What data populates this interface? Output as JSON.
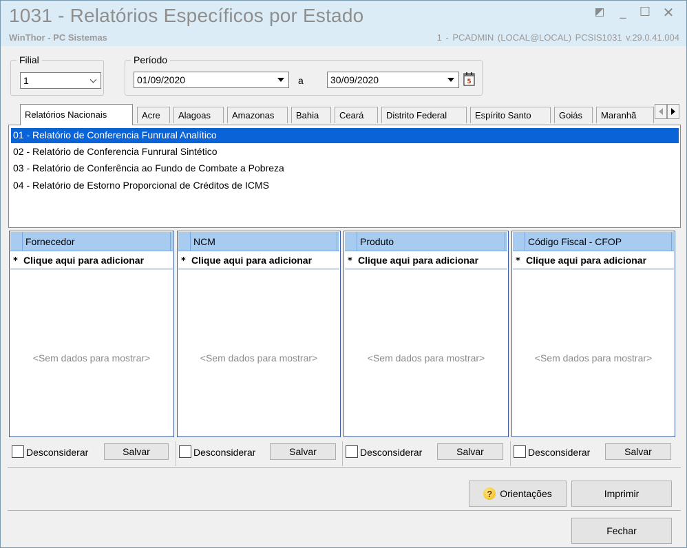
{
  "window": {
    "title": "1031 - Relatórios Específicos por Estado",
    "subtitle": "WinThor - PC Sistemas",
    "info": "1 - PCADMIN (LOCAL@LOCAL)  PCSIS1031  v.29.0.41.004"
  },
  "filters": {
    "filial_label": "Filial",
    "filial_value": "1",
    "periodo_label": "Período",
    "date_start": "01/09/2020",
    "date_separator": "a",
    "date_end": "30/09/2020"
  },
  "tabs": [
    {
      "label": "Relatórios Nacionais",
      "active": true
    },
    {
      "label": "Acre"
    },
    {
      "label": "Alagoas"
    },
    {
      "label": "Amazonas"
    },
    {
      "label": "Bahia"
    },
    {
      "label": "Ceará"
    },
    {
      "label": "Distrito Federal"
    },
    {
      "label": "Espírito Santo"
    },
    {
      "label": "Goiás"
    },
    {
      "label": "Maranhã"
    }
  ],
  "reports": [
    "01 - Relatório de Conferencia Funrural Analítico",
    "02 - Relatório de Conferencia Funrural Sintético",
    "03 - Relatório de Conferência ao Fundo de Combate a Pobreza",
    "04 - Relatório de Estorno Proporcional de Créditos de ICMS"
  ],
  "grids": [
    {
      "header": "Fornecedor",
      "add_row": "Clique aqui para adicionar",
      "empty": "<Sem dados para mostrar>",
      "check_label": "Desconsiderar",
      "save_label": "Salvar"
    },
    {
      "header": "NCM",
      "add_row": "Clique aqui para adicionar",
      "empty": "<Sem dados para mostrar>",
      "check_label": "Desconsiderar",
      "save_label": "Salvar"
    },
    {
      "header": "Produto",
      "add_row": "Clique aqui para adicionar",
      "empty": "<Sem dados para mostrar>",
      "check_label": "Desconsiderar",
      "save_label": "Salvar"
    },
    {
      "header": "Código Fiscal - CFOP",
      "add_row": "Clique aqui para adicionar",
      "empty": "<Sem dados para mostrar>",
      "check_label": "Desconsiderar",
      "save_label": "Salvar"
    }
  ],
  "actions": {
    "orientacoes": "Orientações",
    "imprimir": "Imprimir",
    "fechar": "Fechar"
  },
  "colors": {
    "selection": "#0a64d8",
    "grid_header": "#a8cbf0",
    "title_bar": "#dcecf6"
  }
}
